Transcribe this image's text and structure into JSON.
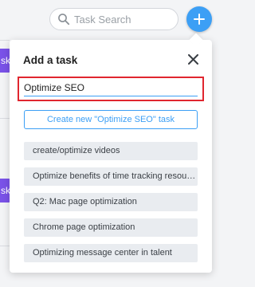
{
  "search": {
    "placeholder": "Task Search"
  },
  "background": {
    "chip_labels": [
      "sk",
      "sk"
    ]
  },
  "popover": {
    "title": "Add a task",
    "input_value": "Optimize SEO",
    "create_button_label": "Create new \"Optimize SEO\" task",
    "suggestions": [
      {
        "label": "create/optimize videos"
      },
      {
        "label": "Optimize benefits of time tracking resources"
      },
      {
        "label": "Q2: Mac page optimization"
      },
      {
        "label": "Chrome page optimization"
      },
      {
        "label": "Optimizing message center in talent"
      }
    ]
  },
  "colors": {
    "accent": "#3c9ff5",
    "highlight": "#e0262f",
    "chip": "#7a52e8"
  },
  "icons": {
    "search": "search-icon",
    "add": "plus-icon",
    "close": "close-icon"
  }
}
